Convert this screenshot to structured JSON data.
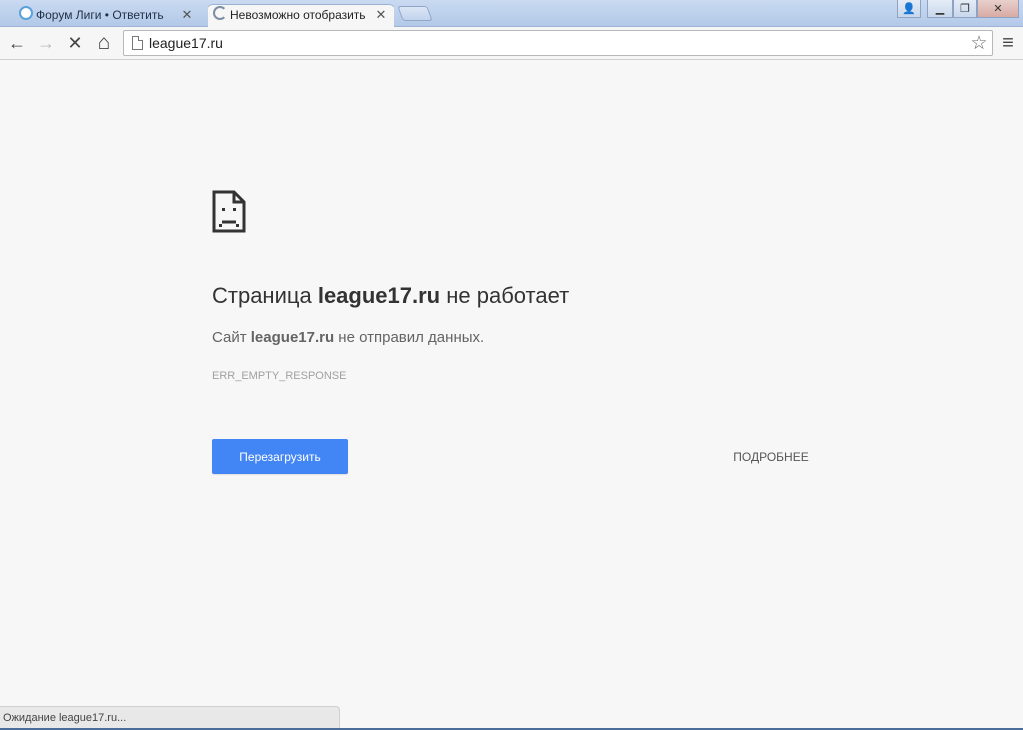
{
  "tabs": [
    {
      "title": "Форум Лиги • Ответить",
      "close": "✕"
    },
    {
      "title": "Невозможно отобразить",
      "close": "✕"
    }
  ],
  "window_controls": {
    "user": "👤",
    "minimize": "▁",
    "restore": "❐",
    "close": "✕"
  },
  "toolbar": {
    "back": "←",
    "forward": "→",
    "stop": "✕",
    "home": "⌂",
    "menu": "≡",
    "url": "league17.ru",
    "star": "☆"
  },
  "error": {
    "heading_prefix": "Страница ",
    "heading_host": "league17.ru",
    "heading_suffix": " не работает",
    "desc_prefix": "Сайт ",
    "desc_host": "league17.ru",
    "desc_suffix": " не отправил данных.",
    "code": "ERR_EMPTY_RESPONSE",
    "reload_label": "Перезагрузить",
    "details_label": "ПОДРОБНЕЕ"
  },
  "status_text": "Ожидание league17.ru...",
  "colors": {
    "accent": "#4285f4",
    "background": "#f7f7f7"
  }
}
